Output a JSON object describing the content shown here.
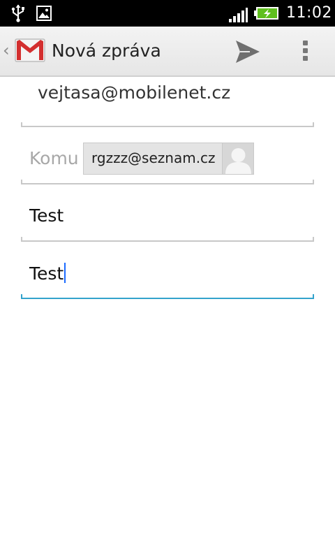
{
  "status_bar": {
    "time": "11:02",
    "icons": [
      "usb-icon",
      "image-icon",
      "signal-icon",
      "battery-charging-icon"
    ]
  },
  "action_bar": {
    "up_glyph": "‹",
    "app_icon": "gmail-icon",
    "title": "Nová zpráva",
    "send_icon": "send-icon",
    "overflow_icon": "overflow-menu-icon"
  },
  "compose": {
    "from": "vejtasa@mobilenet.cz",
    "to_label": "Komu",
    "to_recipients": [
      {
        "address": "rgzzz@seznam.cz",
        "avatar": "contact-avatar-icon"
      }
    ],
    "subject": "Test",
    "body": "Test"
  },
  "colors": {
    "status_bar": "#000000",
    "action_bar": "#ececec",
    "active_underline": "#33a3cc",
    "cursor": "#1a6aff",
    "gmail_red": "#d32f2f"
  }
}
